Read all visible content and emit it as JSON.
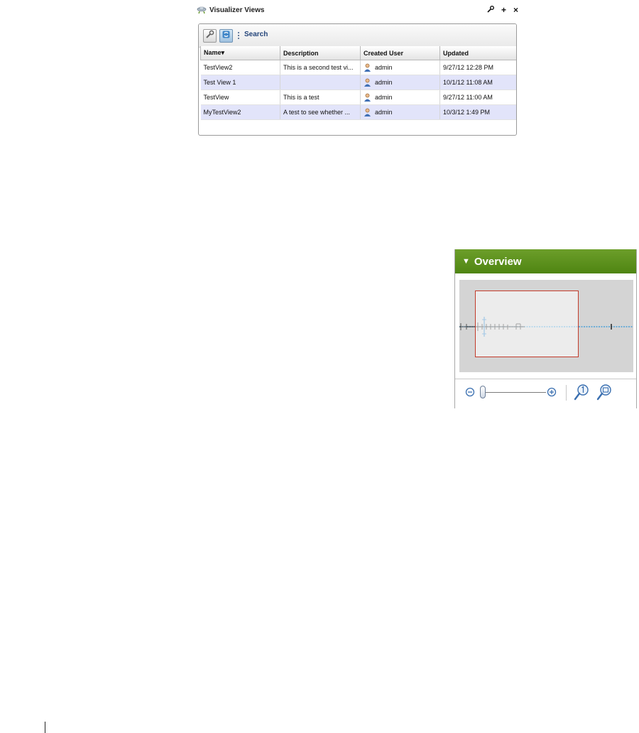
{
  "portlet": {
    "title": "Visualizer Views",
    "controls": {
      "settings": "✦",
      "add": "+",
      "close": "×"
    }
  },
  "toolbar": {
    "search_label": "Search"
  },
  "table": {
    "columns": [
      "Name▾",
      "Description",
      "Created User",
      "Updated"
    ],
    "rows": [
      {
        "name": "TestView2",
        "description": "This is a second test vi...",
        "user": "admin",
        "updated": "9/27/12 12:28 PM"
      },
      {
        "name": "Test View 1",
        "description": "",
        "user": "admin",
        "updated": "10/1/12 11:08 AM"
      },
      {
        "name": "TestView",
        "description": "This is a test",
        "user": "admin",
        "updated": "9/27/12 11:00 AM"
      },
      {
        "name": "MyTestView2",
        "description": "A test to see whether ...",
        "user": "admin",
        "updated": "10/3/12 1:49 PM"
      }
    ]
  },
  "overview": {
    "title": "Overview",
    "accent": "#5a8f1c",
    "frame_color": "#c23a2a",
    "zoom_level": 0
  },
  "icons": [
    "visualizer-icon",
    "wrench-icon",
    "refresh-icon",
    "user-icon",
    "zoom-out-icon",
    "zoom-in-icon",
    "actual-size-icon",
    "fit-to-screen-icon"
  ]
}
